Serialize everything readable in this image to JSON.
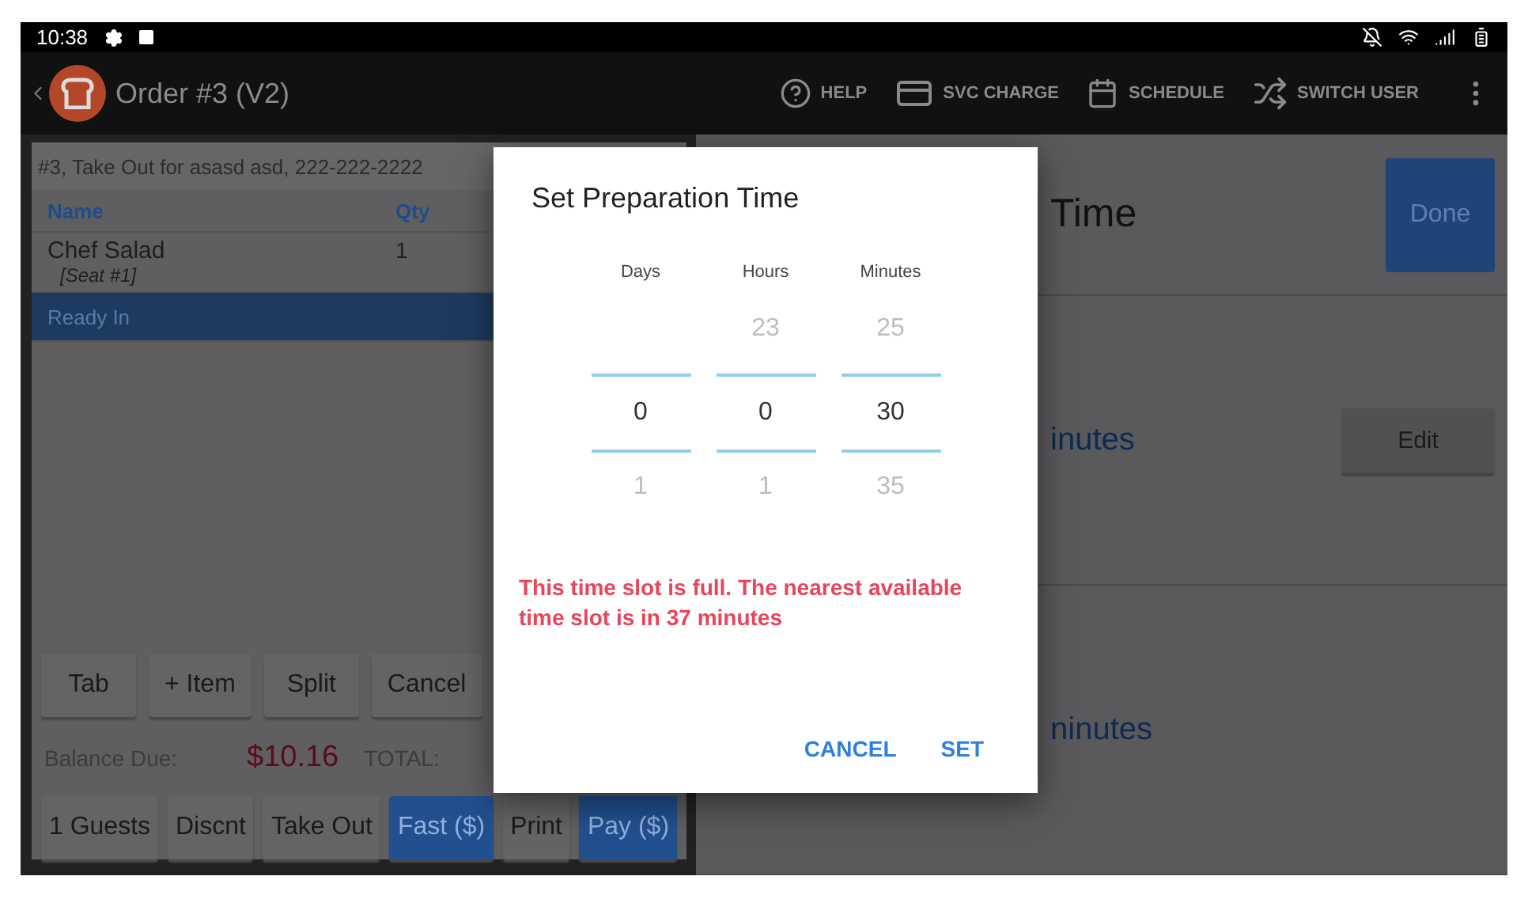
{
  "status_bar": {
    "time": "10:38"
  },
  "toolbar": {
    "title": "Order #3 (V2)",
    "actions": [
      {
        "kind": "help",
        "label": "HELP"
      },
      {
        "kind": "card",
        "label": "SVC CHARGE"
      },
      {
        "kind": "calendar",
        "label": "SCHEDULE"
      },
      {
        "kind": "shuffle",
        "label": "SWITCH USER"
      }
    ]
  },
  "order_panel": {
    "info": "#3, Take Out for asasd asd, 222-222-2222",
    "columns": [
      "Name",
      "Qty"
    ],
    "rows": [
      {
        "kind": "item",
        "name": "Chef Salad",
        "qty": "1",
        "note": "[Seat #1]",
        "selected": false
      },
      {
        "kind": "label",
        "name": "Ready In",
        "selected": true
      }
    ],
    "action_buttons": [
      "Tab",
      "+ Item",
      "Split",
      "Cancel"
    ],
    "balance": {
      "label": "Balance Due:",
      "amount": "$10.16",
      "total_label": "TOTAL:"
    },
    "bottom_buttons": [
      {
        "label": "1 Guests",
        "primary": false
      },
      {
        "label": "Discnt",
        "primary": false
      },
      {
        "label": "Take Out",
        "primary": false
      },
      {
        "label": "Fast ($)",
        "primary": true
      },
      {
        "label": "Print",
        "primary": false
      },
      {
        "label": "Pay ($)",
        "primary": true
      }
    ]
  },
  "right_panel": {
    "heading": "Time",
    "done": "Done",
    "rows": [
      {
        "text": "inutes",
        "button": "Edit"
      },
      {
        "text": "ninutes"
      }
    ]
  },
  "dialog": {
    "title": "Set Preparation Time",
    "columns": [
      {
        "label": "Days",
        "value": "0",
        "next": "1"
      },
      {
        "label": "Hours",
        "prev": "23",
        "value": "0",
        "next": "1"
      },
      {
        "label": "Minutes",
        "prev": "25",
        "value": "30",
        "next": "35"
      }
    ],
    "error": "This time slot is full. The nearest available time slot is in 37 minutes",
    "buttons": [
      "CANCEL",
      "SET"
    ]
  }
}
